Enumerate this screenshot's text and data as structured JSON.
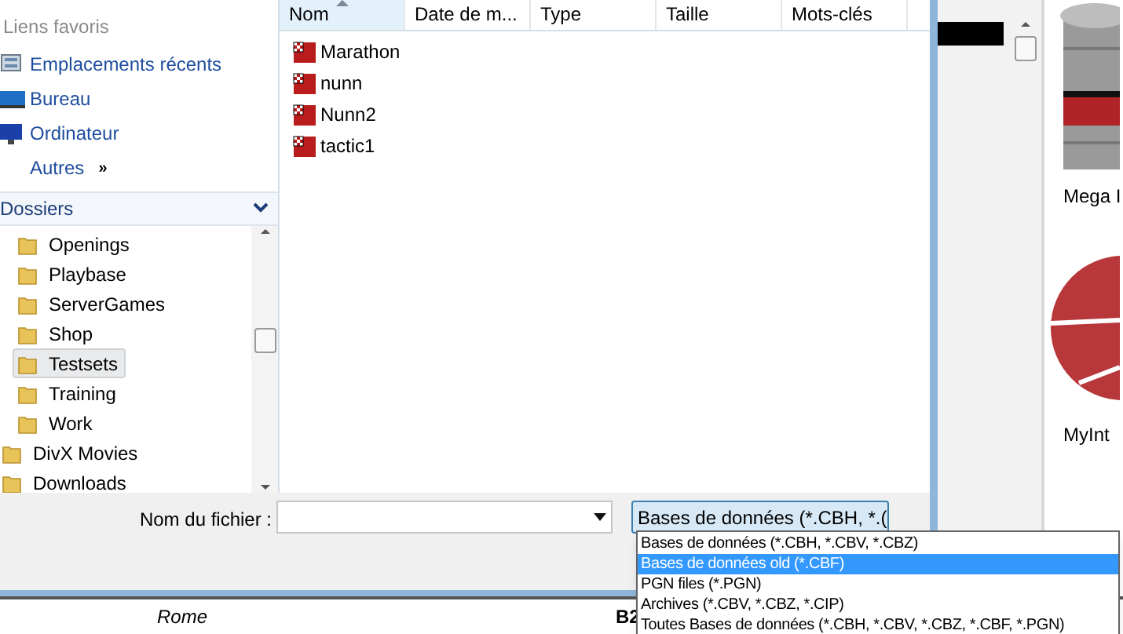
{
  "favorites": {
    "title": "Liens favoris",
    "items": [
      {
        "kind": "recent",
        "label": "Emplacements récents"
      },
      {
        "kind": "desktop",
        "label": "Bureau"
      },
      {
        "kind": "computer",
        "label": "Ordinateur"
      },
      {
        "kind": "more",
        "label": "Autres",
        "chevron": "»"
      }
    ]
  },
  "folders": {
    "title": "Dossiers",
    "tree": [
      {
        "label": "Openings",
        "selected": false
      },
      {
        "label": "Playbase",
        "selected": false
      },
      {
        "label": "ServerGames",
        "selected": false
      },
      {
        "label": "Shop",
        "selected": false
      },
      {
        "label": "Testsets",
        "selected": true
      },
      {
        "label": "Training",
        "selected": false
      },
      {
        "label": "Work",
        "selected": false
      }
    ],
    "roots": [
      {
        "label": "DivX Movies",
        "selected": false
      },
      {
        "label": "Downloads",
        "selected": false
      }
    ]
  },
  "file_list": {
    "columns": [
      {
        "label": "Nom",
        "sorted": true
      },
      {
        "label": "Date de m...",
        "sorted": false
      },
      {
        "label": "Type",
        "sorted": false
      },
      {
        "label": "Taille",
        "sorted": false
      },
      {
        "label": "Mots-clés",
        "sorted": false
      }
    ],
    "files": [
      "Marathon",
      "nunn",
      "Nunn2",
      "tactic1"
    ]
  },
  "filename": {
    "label": "Nom du fichier :"
  },
  "filter": {
    "value": "Bases de données (*.CBH, *.(",
    "options": [
      {
        "label": "Bases de données (*.CBH, *.CBV, *.CBZ)",
        "selected": false
      },
      {
        "label": "Bases de données old (*.CBF)",
        "selected": true
      },
      {
        "label": "PGN files (*.PGN)",
        "selected": false
      },
      {
        "label": "Archives (*.CBV, *.CBZ, *.CIP)",
        "selected": false
      },
      {
        "label": "Toutes Bases de données (*.CBH, *.CBV, *.CBZ, *.CBF, *.PGN)",
        "selected": false
      }
    ]
  },
  "background": {
    "icons": [
      "Mega I",
      "MyInt"
    ],
    "row": {
      "place": "Rome",
      "code": "B2"
    }
  }
}
